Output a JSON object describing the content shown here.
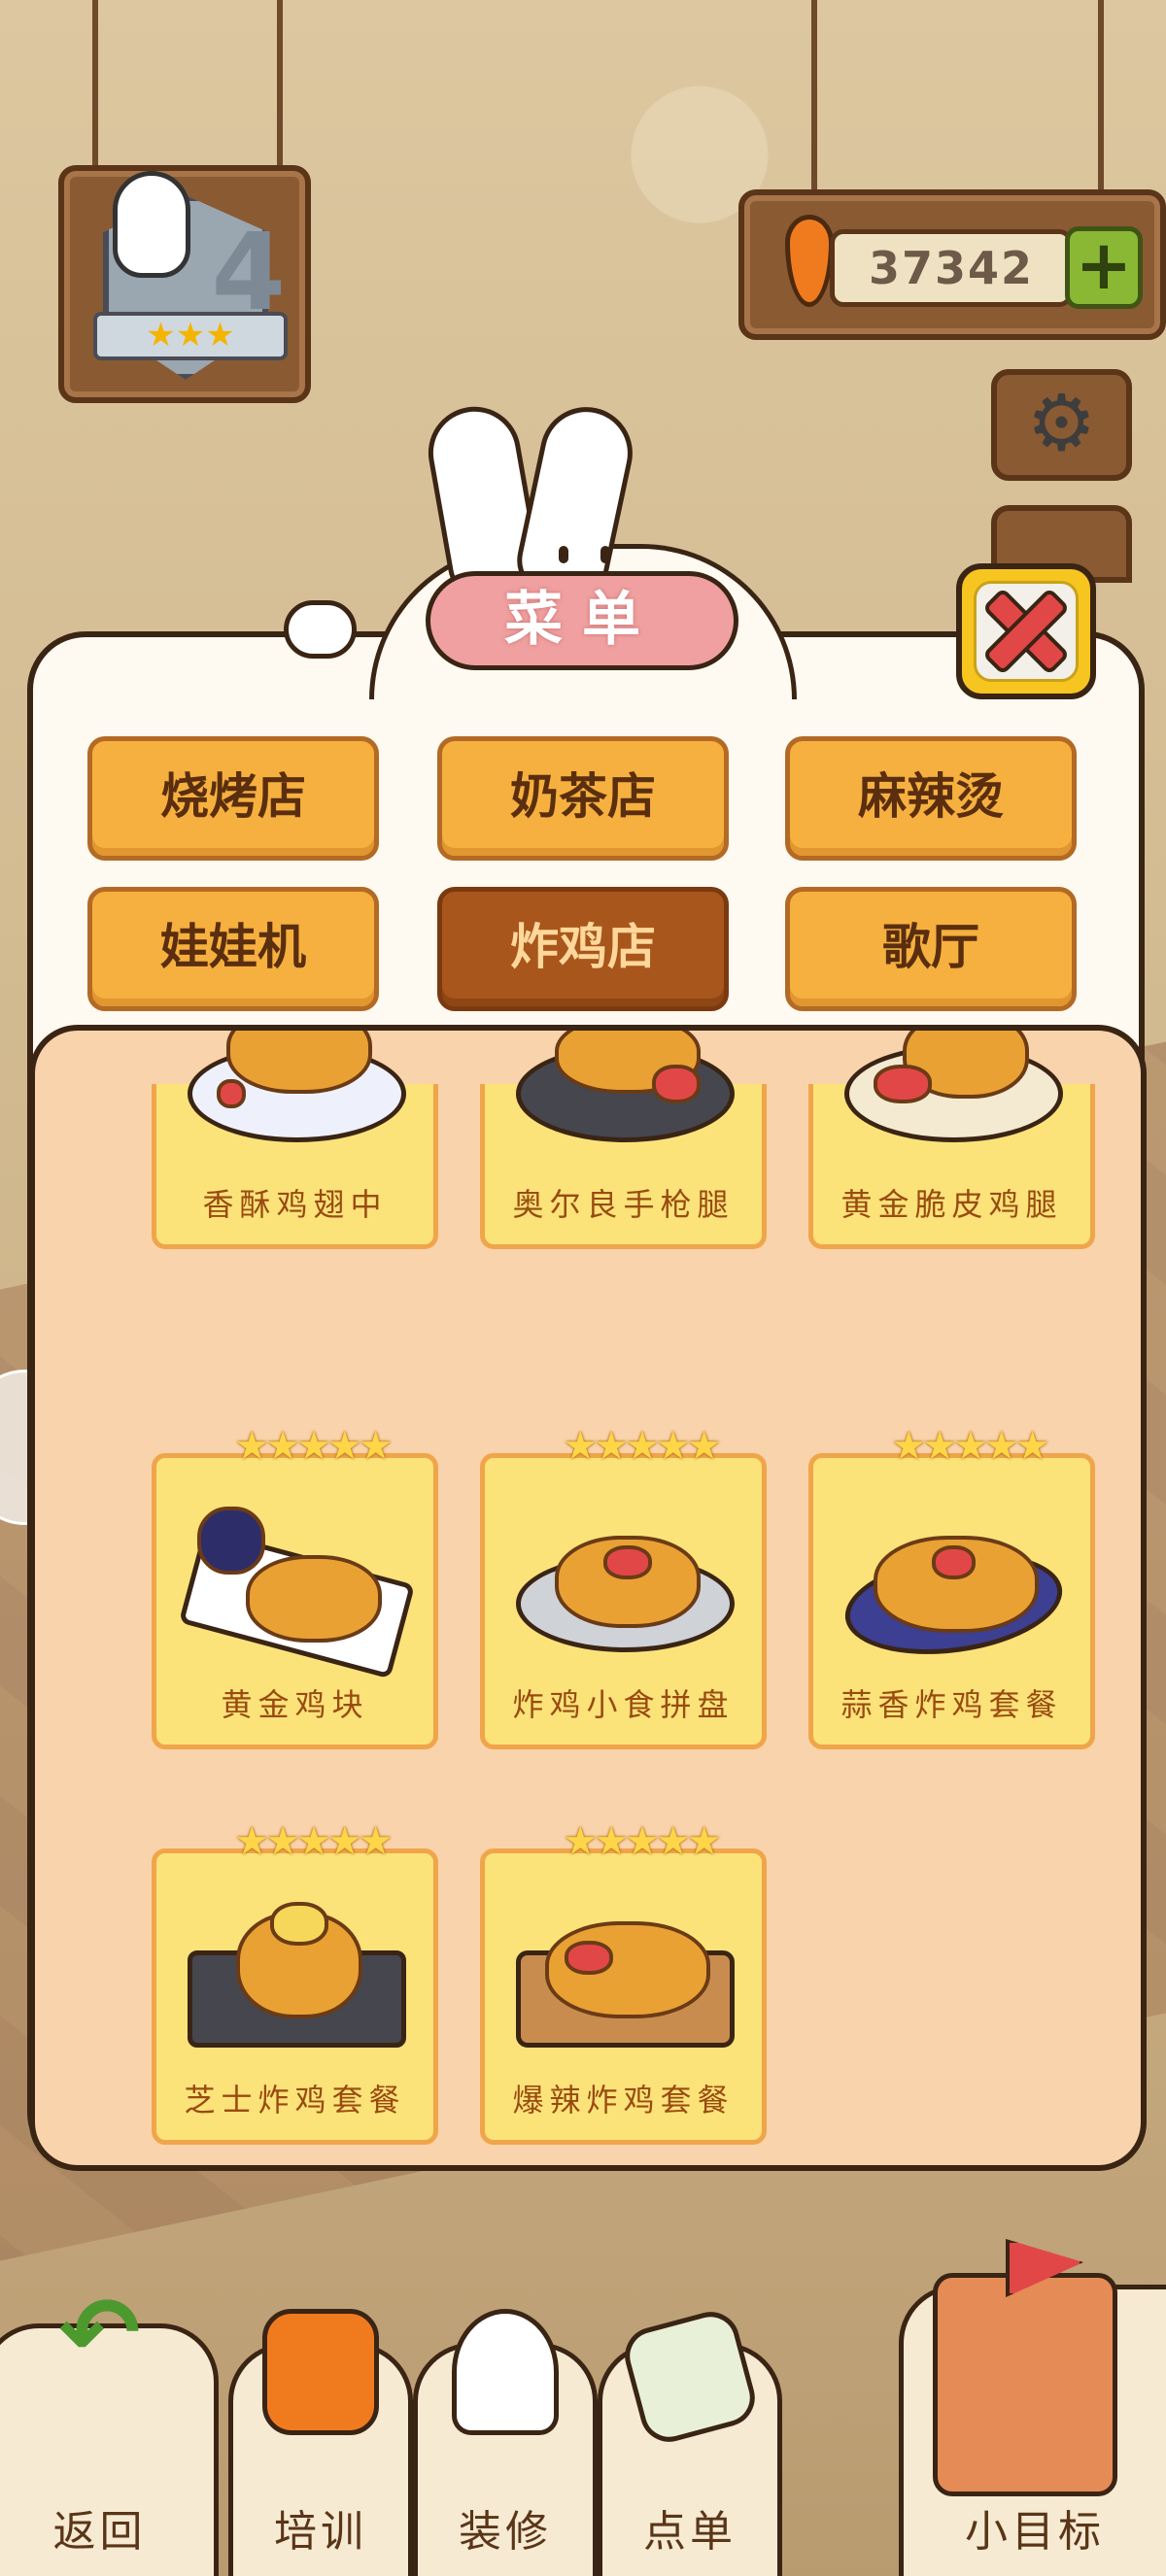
{
  "hud": {
    "level": "4",
    "level_stars": "★★★",
    "carrot_count": "37342",
    "plus_label": "+"
  },
  "menu": {
    "title": "菜单",
    "categories": [
      {
        "label": "烧烤店",
        "active": false
      },
      {
        "label": "奶茶店",
        "active": false
      },
      {
        "label": "麻辣烫",
        "active": false
      },
      {
        "label": "娃娃机",
        "active": false
      },
      {
        "label": "炸鸡店",
        "active": true
      },
      {
        "label": "歌厅",
        "active": false
      }
    ],
    "dishes": [
      {
        "name": "香酥鸡翅中",
        "stars": ""
      },
      {
        "name": "奥尔良手枪腿",
        "stars": ""
      },
      {
        "name": "黄金脆皮鸡腿",
        "stars": ""
      },
      {
        "name": "黄金鸡块",
        "stars": "★★★★★"
      },
      {
        "name": "炸鸡小食拼盘",
        "stars": "★★★★★"
      },
      {
        "name": "蒜香炸鸡套餐",
        "stars": "★★★★★"
      },
      {
        "name": "芝士炸鸡套餐",
        "stars": "★★★★★"
      },
      {
        "name": "爆辣炸鸡套餐",
        "stars": "★★★★★"
      }
    ]
  },
  "bottom_nav": {
    "back": "返回",
    "train": "培训",
    "decorate": "装修",
    "order": "点单",
    "goal": "小目标"
  },
  "icons": {
    "close": "close-icon",
    "settings": "gear-icon",
    "back": "back-arrow-icon"
  },
  "colors": {
    "tab_active": "#a8561c",
    "tab_normal": "#f6b03f",
    "card_bg": "#fbe37a",
    "panel_bg": "#f9d3ab",
    "title_pill": "#f0a0a0"
  }
}
